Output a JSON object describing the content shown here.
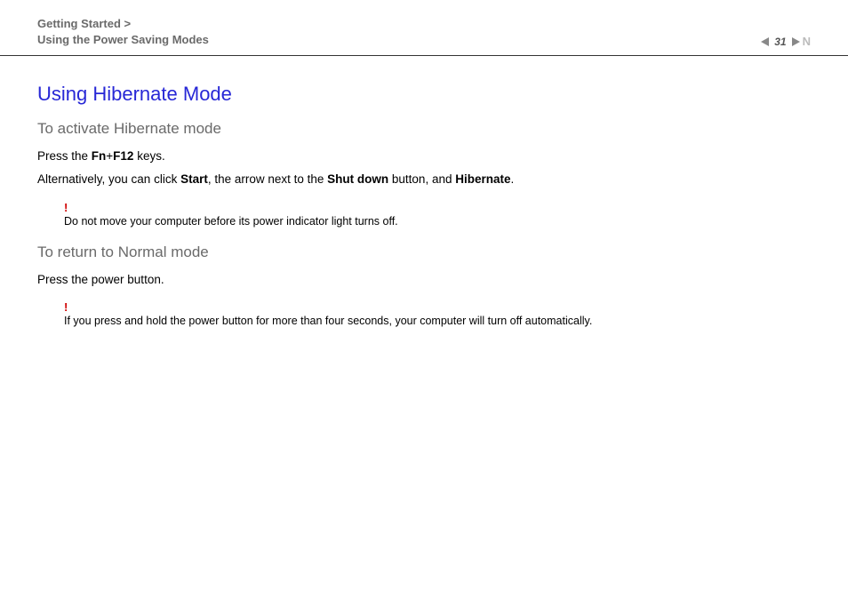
{
  "header": {
    "breadcrumb_line1": "Getting Started >",
    "breadcrumb_line2": "Using the Power Saving Modes",
    "page_number": "31"
  },
  "content": {
    "main_heading": "Using Hibernate Mode",
    "section1": {
      "heading": "To activate Hibernate mode",
      "para1_pre": "Press the ",
      "para1_key1": "Fn",
      "para1_plus": "+",
      "para1_key2": "F12",
      "para1_post": " keys.",
      "para2_pre": "Alternatively, you can click ",
      "para2_b1": "Start",
      "para2_mid1": ", the arrow next to the ",
      "para2_b2": "Shut down",
      "para2_mid2": " button, and ",
      "para2_b3": "Hibernate",
      "para2_post": ".",
      "warning_mark": "!",
      "warning_text": "Do not move your computer before its power indicator light turns off."
    },
    "section2": {
      "heading": "To return to Normal mode",
      "para1": "Press the power button.",
      "warning_mark": "!",
      "warning_text": "If you press and hold the power button for more than four seconds, your computer will turn off automatically."
    }
  }
}
